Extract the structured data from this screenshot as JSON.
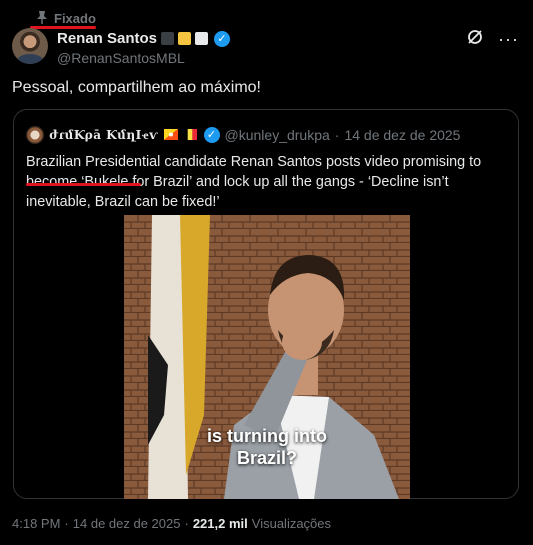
{
  "pinned": {
    "label": "Fixado"
  },
  "author": {
    "name": "Renan Santos",
    "handle": "@RenanSantosMBL",
    "badge_colors": [
      "#3a3f45",
      "#f5c542",
      "#e7e9ea"
    ]
  },
  "tweet": {
    "text": "Pessoal, compartilhem ao máximo!"
  },
  "quote": {
    "name": "ժɾմƘρā ƘմղӀҽѵ",
    "handle": "@kunley_drukpa",
    "separator": "·",
    "date": "14 de dez de 2025",
    "text": "Brazilian Presidential candidate Renan Santos posts video promising to become ‘Bukele for Brazil’ and lock up all the gangs - ‘Decline isn’t inevitable, Brazil can be fixed!’",
    "video_caption_line1": "is turning into",
    "video_caption_line2": "Brazil?"
  },
  "footer": {
    "time": "4:18 PM",
    "separator": "·",
    "date": "14 de dez de 2025",
    "separator2": "·",
    "views": "221,2 mil",
    "views_label": "Visualizações"
  },
  "colors": {
    "accent": "#1d9bf0",
    "highlight": "#e0141e",
    "muted": "#71767b"
  },
  "icons": [
    "pin-icon",
    "verified-icon",
    "grok-icon",
    "more-icon"
  ]
}
